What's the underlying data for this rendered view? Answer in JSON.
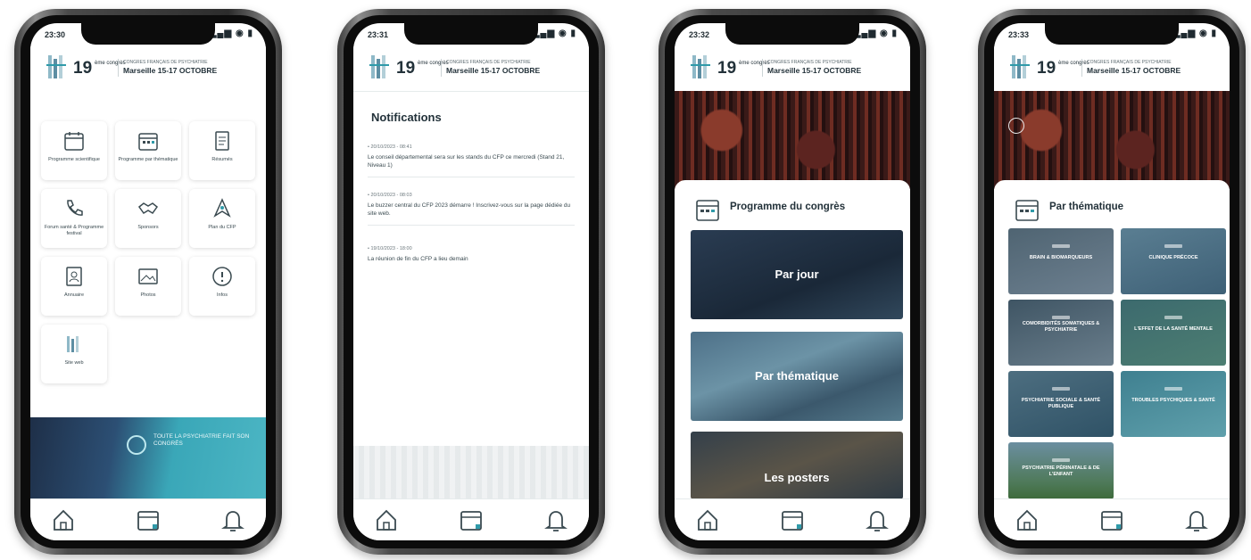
{
  "status": {
    "time_1": "23:30",
    "time_2": "23:31",
    "time_3": "23:32",
    "time_4": "23:33",
    "icons": "▂▄▆ ◉ ▮"
  },
  "header": {
    "number": "19",
    "sup": "ème congrès",
    "line1": "CONGRES FRANÇAIS DE PSYCHIATRIE",
    "line2": "Marseille 15-17 OCTOBRE"
  },
  "home": {
    "tiles": [
      {
        "label": "Programme scientifique"
      },
      {
        "label": "Programme par thématique"
      },
      {
        "label": "Résumés"
      },
      {
        "label": "Forum santé & Programme festival"
      },
      {
        "label": "Sponsors"
      },
      {
        "label": "Plan du CFP"
      },
      {
        "label": "Annuaire"
      },
      {
        "label": "Photos"
      },
      {
        "label": "Infos"
      },
      {
        "label": "Site web"
      }
    ],
    "banner_text": "TOUTE LA PSYCHIATRIE FAIT SON CONGRÈS"
  },
  "notifications": {
    "title": "Notifications",
    "items": [
      {
        "date": "• 20/10/2023 - 08:41",
        "text": "Le conseil départemental sera sur les stands du CFP ce mercredi (Stand 21, Niveau 1)"
      },
      {
        "date": "• 20/10/2023 - 08:03",
        "text": "Le buzzer central du CFP 2023 démarre ! Inscrivez-vous sur la page dédiée du site web."
      },
      {
        "date": "• 19/10/2023 - 18:00",
        "text": "La réunion de fin du CFP a lieu demain"
      }
    ]
  },
  "programme": {
    "title": "Programme du congrès",
    "buttons": [
      {
        "label": "Par jour"
      },
      {
        "label": "Par thématique"
      },
      {
        "label": "Les posters"
      }
    ]
  },
  "thematique": {
    "title": "Par thématique",
    "items": [
      {
        "label": "BRAIN & BIOMARQUEURS"
      },
      {
        "label": "CLINIQUE PRÉCOCE"
      },
      {
        "label": "COMORBIDITÉS SOMATIQUES & PSYCHIATRIE"
      },
      {
        "label": "L'EFFET DE LA SANTÉ MENTALE"
      },
      {
        "label": "PSYCHIATRIE SOCIALE & SANTÉ PUBLIQUE"
      },
      {
        "label": "TROUBLES PSYCHIQUES & SANTÉ"
      },
      {
        "label": "PSYCHIATRIE PÉRINATALE & DE L'ENFANT"
      }
    ]
  },
  "colors": {
    "accent": "#2f9aa9",
    "dark": "#23323a",
    "navy": "#1e2f48"
  }
}
